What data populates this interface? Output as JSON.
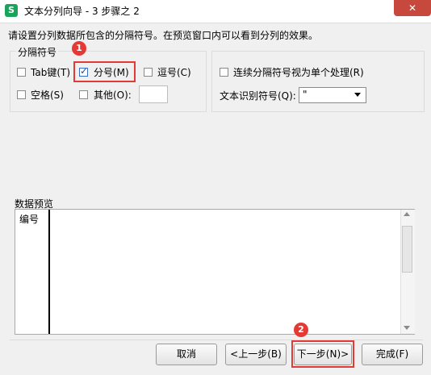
{
  "window": {
    "title": "文本分列向导 - 3 步骤之 2",
    "app_icon_letter": "S",
    "close_glyph": "✕"
  },
  "instruction": "请设置分列数据所包含的分隔符号。在预览窗口内可以看到分列的效果。",
  "delimiters": {
    "group_label": "分隔符号",
    "tab": {
      "label": "Tab键(T)",
      "checked": false
    },
    "semicolon": {
      "label": "分号(M)",
      "checked": true
    },
    "comma": {
      "label": "逗号(C)",
      "checked": false
    },
    "space": {
      "label": "空格(S)",
      "checked": false
    },
    "other": {
      "label": "其他(O):",
      "checked": false,
      "value": ""
    }
  },
  "options": {
    "consecutive": {
      "label": "连续分隔符号视为单个处理(R)",
      "checked": false
    },
    "qualifier_label": "文本识别符号(Q):",
    "qualifier_value": "\""
  },
  "preview": {
    "label": "数据预览",
    "column_header": "编号"
  },
  "markers": {
    "m1": "1",
    "m2": "2"
  },
  "buttons": {
    "cancel": "取消",
    "back": "<上一步(B)",
    "next": "下一步(N)>",
    "finish": "完成(F)"
  },
  "colors": {
    "accent_red": "#e53935",
    "close_red": "#c7483d",
    "app_green": "#1aa35b"
  }
}
